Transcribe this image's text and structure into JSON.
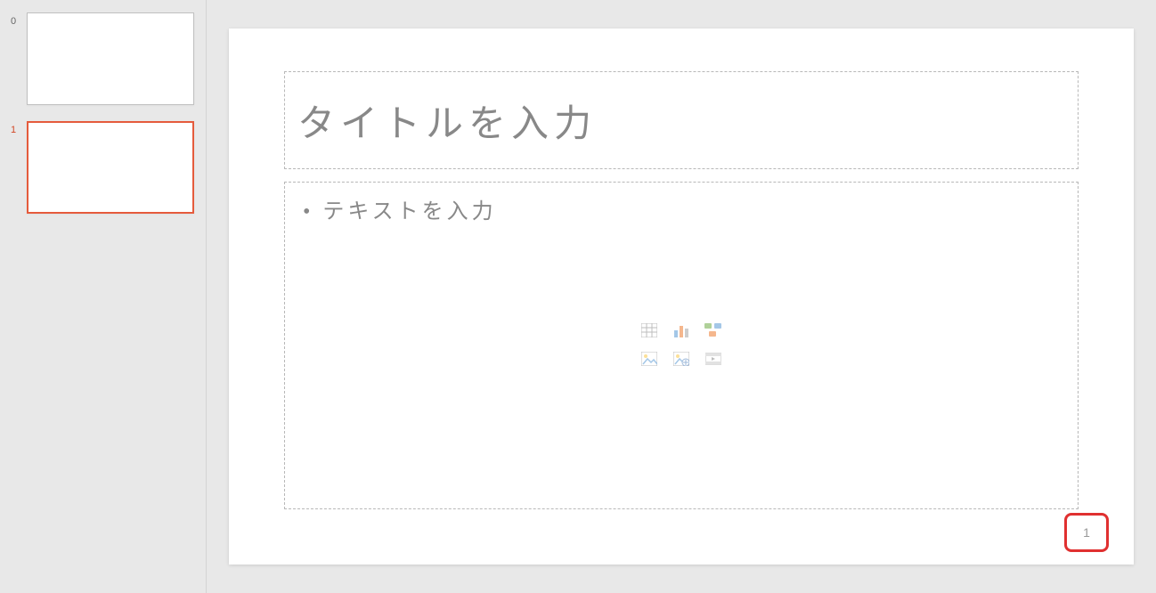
{
  "sidebar": {
    "thumbnails": [
      {
        "number": "0",
        "selected": false
      },
      {
        "number": "1",
        "selected": true
      }
    ]
  },
  "slide": {
    "titlePlaceholder": "タイトルを入力",
    "bulletPlaceholder": "• テキストを入力",
    "pageNumber": "1",
    "insertIcons": {
      "table": "insert-table-icon",
      "chart": "insert-chart-icon",
      "smartart": "insert-smartart-icon",
      "picture": "insert-picture-icon",
      "onlinePicture": "insert-online-picture-icon",
      "video": "insert-video-icon"
    }
  },
  "colors": {
    "selection": "#e55b3c",
    "highlight": "#e03030",
    "placeholder": "#888888"
  }
}
